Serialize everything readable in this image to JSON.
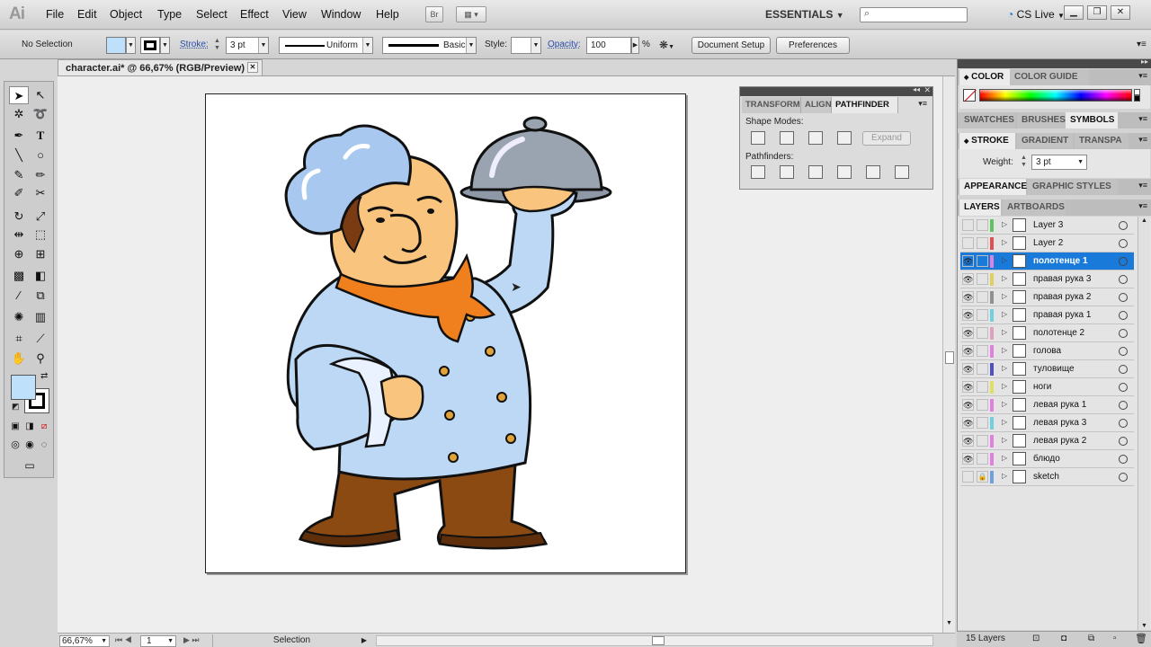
{
  "app": {
    "logo": "Ai"
  },
  "menu": [
    "File",
    "Edit",
    "Object",
    "Type",
    "Select",
    "Effect",
    "View",
    "Window",
    "Help"
  ],
  "topbar": {
    "bridge_label": "Br",
    "workspace": "ESSENTIALS",
    "cs_live": "CS Live",
    "search_value": ""
  },
  "control": {
    "selection_status": "No Selection",
    "stroke_label": "Stroke:",
    "stroke_weight": "3 pt",
    "profile_label": "Uniform",
    "brush_label": "Basic",
    "style_label": "Style:",
    "opacity_label": "Opacity:",
    "opacity_value": "100",
    "opacity_unit": "%",
    "document_setup": "Document Setup",
    "preferences": "Preferences"
  },
  "document": {
    "tab_title": "character.ai* @ 66,67% (RGB/Preview)"
  },
  "status": {
    "zoom": "66,67%",
    "artboard_number": "1",
    "tool_status": "Selection"
  },
  "pathfinder_panel": {
    "tabs": [
      "TRANSFORM",
      "ALIGN",
      "PATHFINDER"
    ],
    "shape_modes_label": "Shape Modes:",
    "expand_label": "Expand",
    "pathfinders_label": "Pathfinders:"
  },
  "right_dock": {
    "color_tab": "COLOR",
    "color_guide_tab": "COLOR GUIDE",
    "swatches_tab": "SWATCHES",
    "brushes_tab": "BRUSHES",
    "symbols_tab": "SYMBOLS",
    "stroke_tab": "STROKE",
    "gradient_tab": "GRADIENT",
    "transparency_tab": "TRANSPA",
    "weight_label": "Weight:",
    "weight_value": "3 pt",
    "appearance_tab": "APPEARANCE",
    "graphic_styles_tab": "GRAPHIC STYLES",
    "layers_tab": "LAYERS",
    "artboards_tab": "ARTBOARDS"
  },
  "layers": [
    {
      "name": "Layer 3",
      "visible": false,
      "locked": false,
      "color": "#5fc35f",
      "selected": false
    },
    {
      "name": "Layer 2",
      "visible": false,
      "locked": false,
      "color": "#e05050",
      "selected": false
    },
    {
      "name": "полотенце 1",
      "visible": true,
      "locked": false,
      "color": "#e080e0",
      "selected": true
    },
    {
      "name": "правая рука 3",
      "visible": true,
      "locked": false,
      "color": "#e0d060",
      "selected": false
    },
    {
      "name": "правая рука 2",
      "visible": true,
      "locked": false,
      "color": "#909090",
      "selected": false
    },
    {
      "name": "правая рука 1",
      "visible": true,
      "locked": false,
      "color": "#70d0e0",
      "selected": false
    },
    {
      "name": "полотенце 2",
      "visible": true,
      "locked": false,
      "color": "#e0a0c0",
      "selected": false
    },
    {
      "name": "голова",
      "visible": true,
      "locked": false,
      "color": "#e080e0",
      "selected": false
    },
    {
      "name": "туловище",
      "visible": true,
      "locked": false,
      "color": "#5050c0",
      "selected": false
    },
    {
      "name": "ноги",
      "visible": true,
      "locked": false,
      "color": "#e0e060",
      "selected": false
    },
    {
      "name": "левая рука 1",
      "visible": true,
      "locked": false,
      "color": "#e080e0",
      "selected": false
    },
    {
      "name": "левая рука 3",
      "visible": true,
      "locked": false,
      "color": "#70d0e0",
      "selected": false
    },
    {
      "name": "левая рука 2",
      "visible": true,
      "locked": false,
      "color": "#e080e0",
      "selected": false
    },
    {
      "name": "блюдо",
      "visible": true,
      "locked": false,
      "color": "#e080e0",
      "selected": false
    },
    {
      "name": "sketch",
      "visible": false,
      "locked": true,
      "color": "#70a0e0",
      "selected": false
    }
  ],
  "layers_footer": {
    "count": "15 Layers"
  },
  "colors": {
    "fill_swatch": "#bfe0fa",
    "selection_blue": "#1a7ad9",
    "chef_coat": "#bcd8f5",
    "scarf": "#f07f1e"
  }
}
